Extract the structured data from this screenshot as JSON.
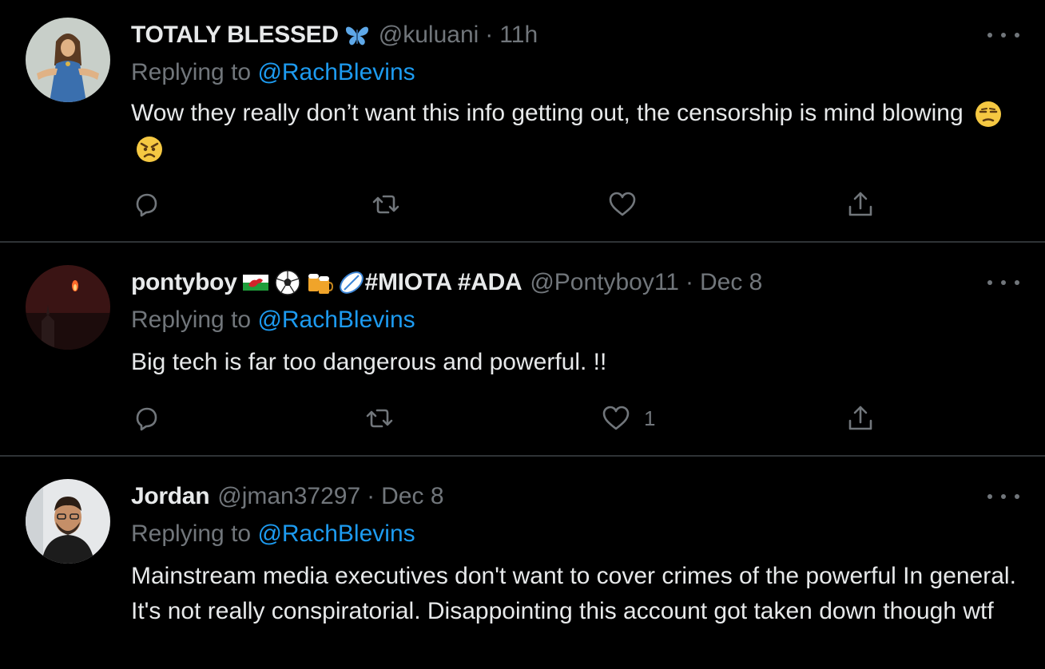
{
  "tweets": [
    {
      "name": "TOTALY BLESSED",
      "name_icons": [
        "butterfly-icon"
      ],
      "handle": "@kuluani",
      "separator": "·",
      "time": "11h",
      "replying_prefix": "Replying to",
      "replying_to": "@RachBlevins",
      "text": "Wow they really don’t want this info getting out, the censorship is mind blowing",
      "text_icons": [
        "unamused-face-icon",
        "angry-face-icon"
      ],
      "like_count": ""
    },
    {
      "name": "pontyboy",
      "name_icons": [
        "wales-flag-icon",
        "soccer-ball-icon",
        "beer-mugs-icon",
        "rugby-ball-icon"
      ],
      "name_suffix": "#MIOTA #ADA",
      "handle": "@Pontyboy11",
      "separator": "·",
      "time": "Dec 8",
      "replying_prefix": "Replying to",
      "replying_to": "@RachBlevins",
      "text": "Big tech is far too dangerous and powerful. !!",
      "like_count": "1"
    },
    {
      "name": "Jordan",
      "handle": "@jman37297",
      "separator": "·",
      "time": "Dec 8",
      "replying_prefix": "Replying to",
      "replying_to": "@RachBlevins",
      "text": "Mainstream media executives don't want to cover crimes of the powerful In general. It's not really conspiratorial. Disappointing this account got taken down though wtf",
      "like_count": ""
    }
  ],
  "colors": {
    "background": "#000000",
    "text": "#e7e9ea",
    "muted": "#71767b",
    "link": "#1d9bf0",
    "divider": "#2f3336"
  }
}
